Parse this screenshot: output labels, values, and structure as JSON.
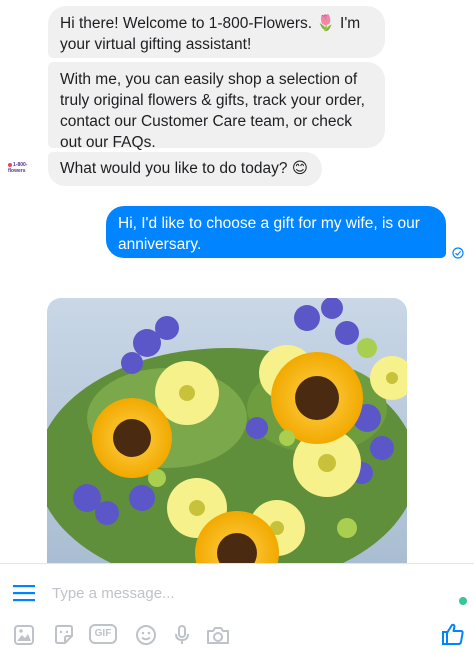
{
  "conversation": {
    "bot_name": "1-800-Flowers",
    "bot_avatar_text": "1-800-flowers",
    "messages": [
      {
        "from": "bot",
        "text": "Hi there! Welcome to 1-800-Flowers. 🌷 I'm your virtual gifting assistant!"
      },
      {
        "from": "bot",
        "text": "With me, you can easily shop a selection of truly original flowers & gifts, track your order, contact our Customer Care team, or check out our FAQs."
      },
      {
        "from": "bot",
        "text": "What would you like to do today? 😊"
      },
      {
        "from": "user",
        "text": "Hi, I'd like to choose a gift for my wife, is our anniversary."
      }
    ],
    "image_subject": "bouquet-of-sunflowers-and-daisies"
  },
  "composer": {
    "placeholder": "Type a message...",
    "gif_label": "GIF",
    "tools": [
      "menu-icon",
      "image-icon",
      "sticker-icon",
      "gif-icon",
      "emoji-icon",
      "microphone-icon",
      "camera-icon",
      "thumbs-up-icon"
    ]
  },
  "colors": {
    "brand_blue": "#0084ff",
    "bot_bubble": "#f1f0f0",
    "icon_gray": "#bec3c9",
    "online_green": "#35c69a"
  }
}
